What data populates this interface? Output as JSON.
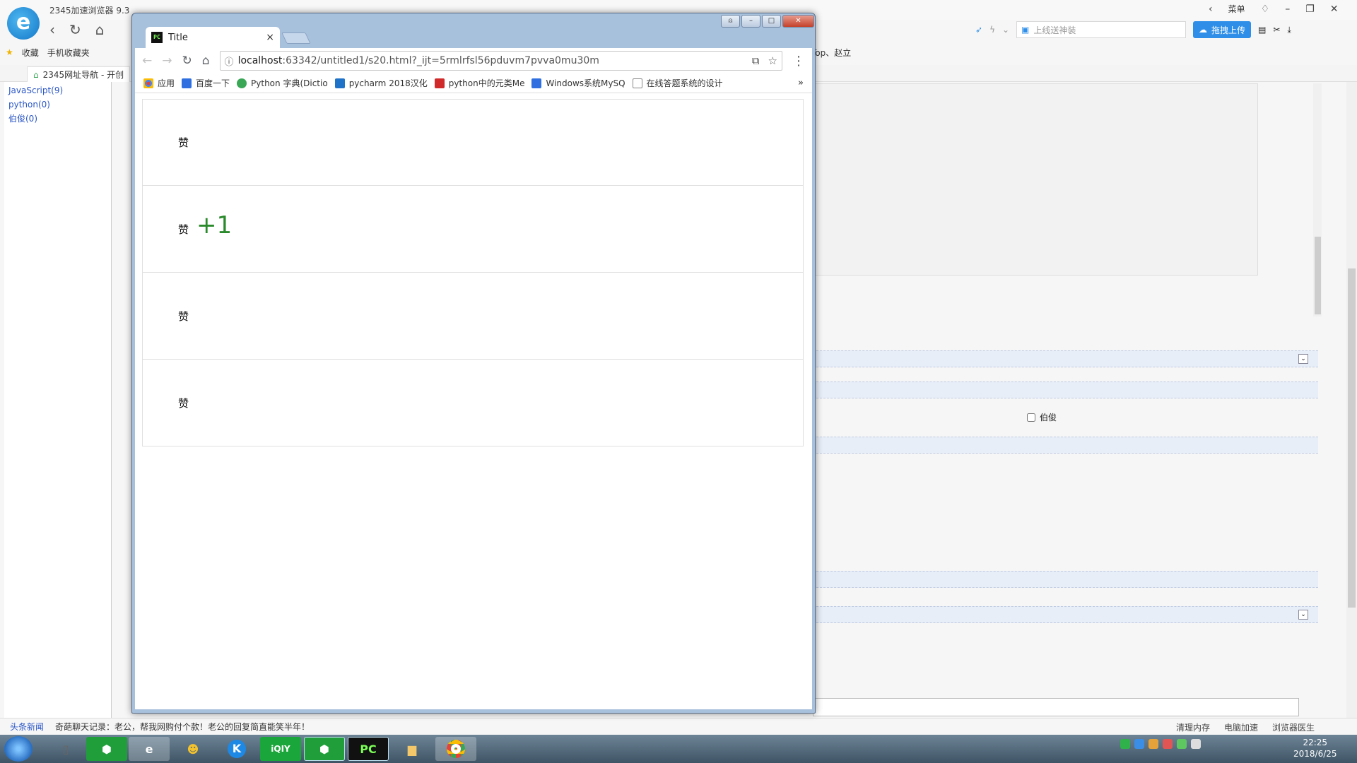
{
  "background_browser": {
    "app_title": "2345加速浏览器 9.3",
    "menu_label": "菜单",
    "search_placeholder": "上线送神装",
    "upload_button": "拖拽上传",
    "favorites": [
      "收藏",
      "手机收藏夹"
    ],
    "favbar_right": "Top、赵立",
    "tab_label": "2345网址导航 - 开创",
    "sidebar_links": [
      "JavaScript(9)",
      "python(0)",
      "伯俊(0)"
    ],
    "checkbox_label": "伯俊",
    "news_label": "头条新闻",
    "news_text": "奇葩聊天记录：老公，帮我网购付个款！老公的回复简直能笑半年！",
    "status_items": [
      "清理内存",
      "电脑加速",
      "浏览器医生"
    ]
  },
  "chrome": {
    "tab_title": "Title",
    "tab_close": "×",
    "url_host": "localhost",
    "url_rest": ":63342/untitled1/s20.html?_ijt=5rmlrfsl56pduvm7pvva0mu30m",
    "bookmarks": [
      {
        "label": "应用",
        "color": "#e94235"
      },
      {
        "label": "百度一下",
        "color": "#2f6fe0"
      },
      {
        "label": "Python 字典(Dictio",
        "color": "#3aa757"
      },
      {
        "label": "pycharm 2018汉化",
        "color": "#1e73c9"
      },
      {
        "label": "python中的元类Me",
        "color": "#d12a2a"
      },
      {
        "label": "Windows系统MySQ",
        "color": "#2f6fe0"
      },
      {
        "label": "在线答题系统的设计",
        "color": "#888888"
      }
    ],
    "bookmarks_more": "»"
  },
  "page": {
    "rows": [
      {
        "like": "赞",
        "plus": ""
      },
      {
        "like": "赞",
        "plus": "+1"
      },
      {
        "like": "赞",
        "plus": ""
      },
      {
        "like": "赞",
        "plus": ""
      }
    ]
  },
  "taskbar": {
    "clock_time": "22:25",
    "clock_date": "2018/6/25"
  },
  "colors": {
    "plus_one": "#2b8a2b",
    "link": "#2a56c6"
  }
}
